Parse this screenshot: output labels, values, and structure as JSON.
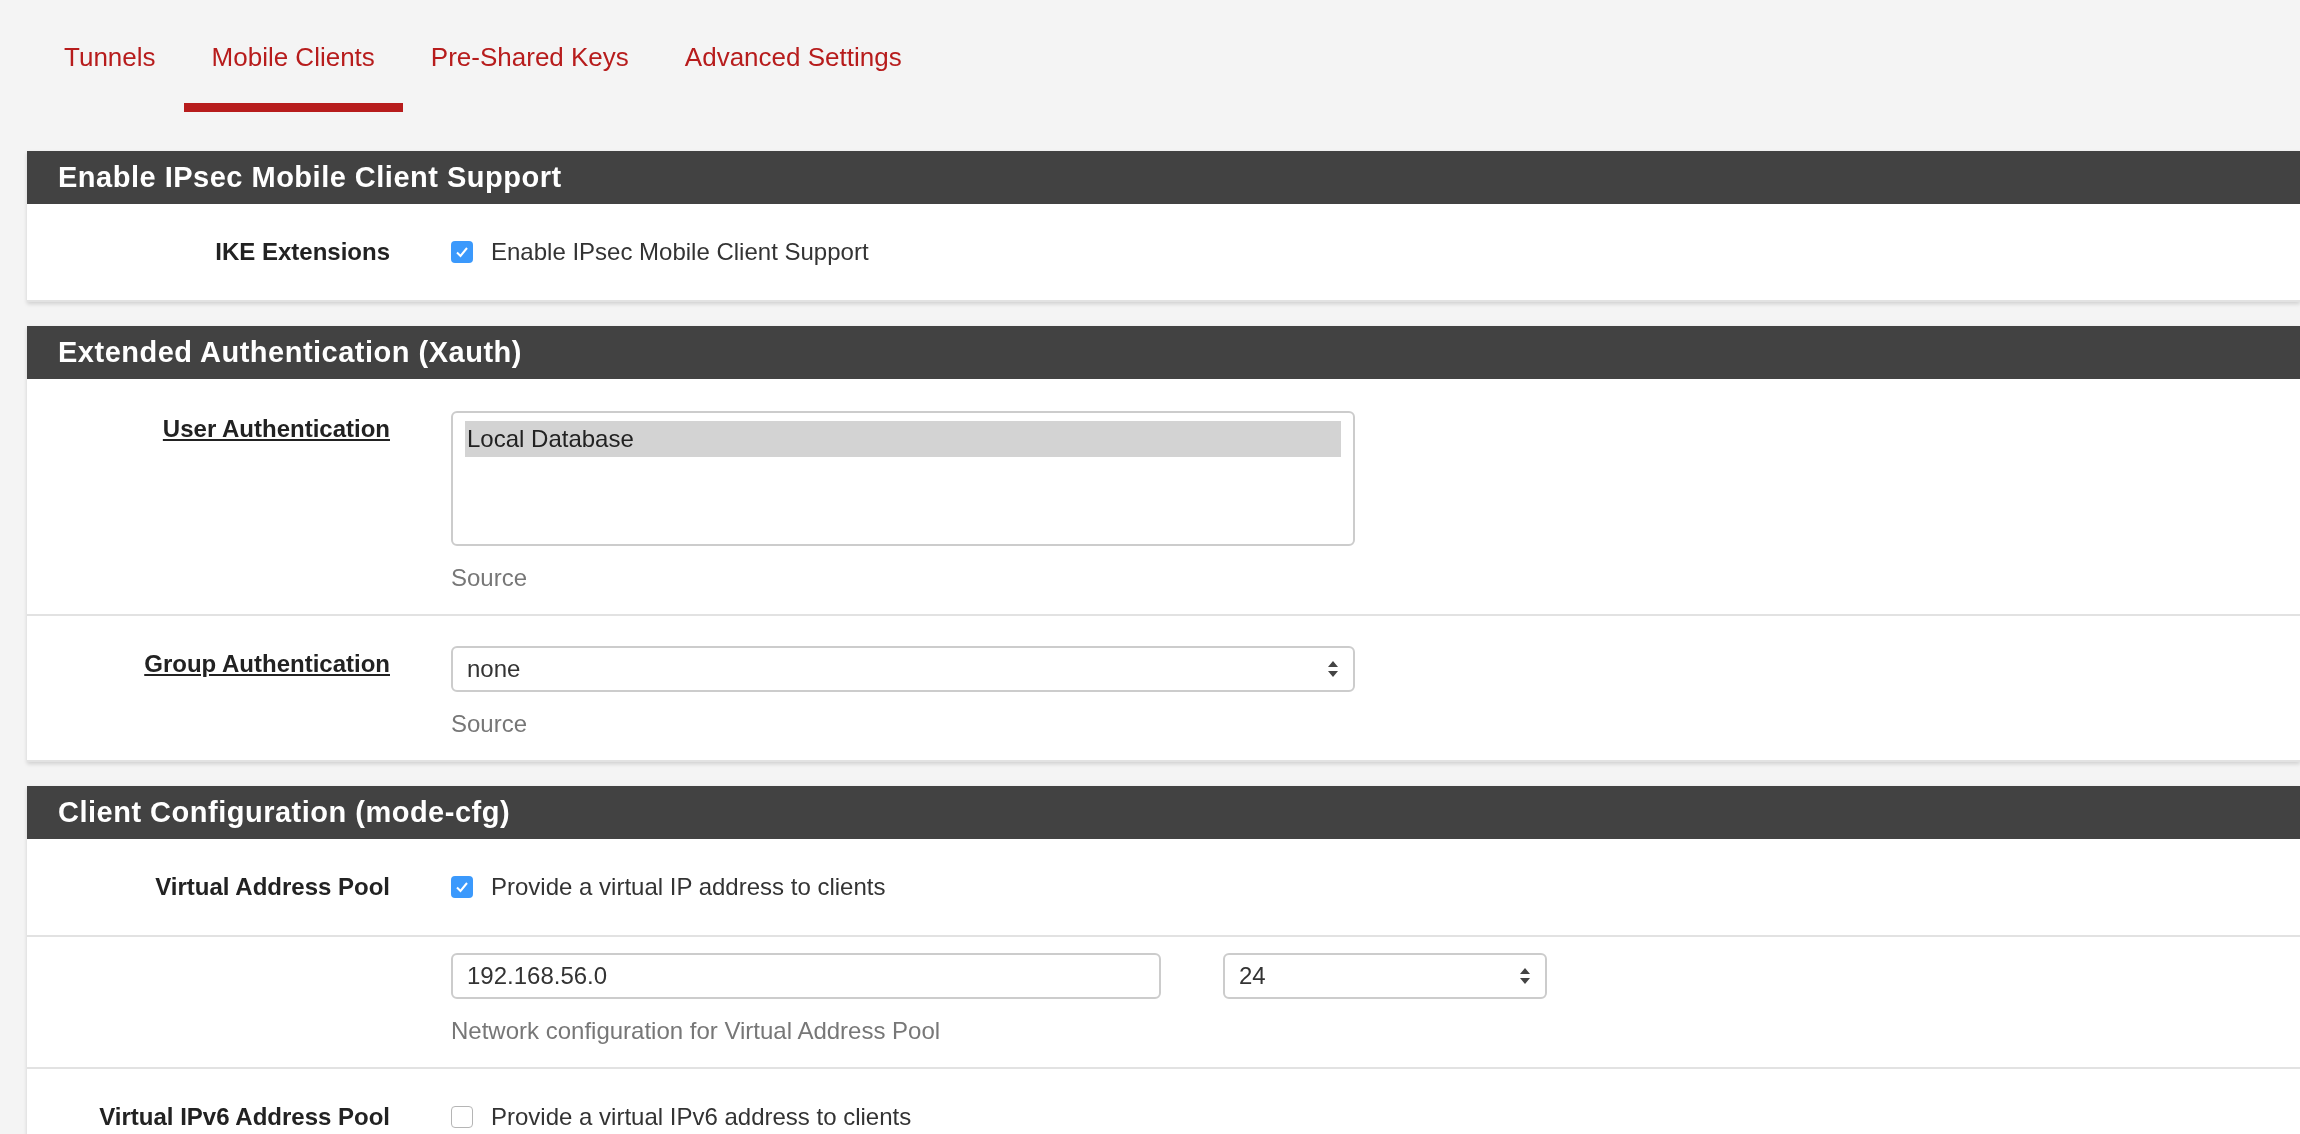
{
  "tabs": [
    {
      "label": "Tunnels",
      "selected": false
    },
    {
      "label": "Mobile Clients",
      "selected": true
    },
    {
      "label": "Pre-Shared Keys",
      "selected": false
    },
    {
      "label": "Advanced Settings",
      "selected": false
    }
  ],
  "sections": [
    {
      "title": "Enable IPsec Mobile Client Support",
      "rows": [
        {
          "kind": "checkbox",
          "label": "IKE Extensions",
          "linked": false,
          "checkbox": {
            "label": "Enable IPsec Mobile Client Support",
            "checked": true
          }
        }
      ]
    },
    {
      "title": "Extended Authentication (Xauth)",
      "rows": [
        {
          "kind": "listbox",
          "label": "User Authentication",
          "linked": true,
          "options": [
            {
              "label": "Local Database",
              "selected": true
            }
          ],
          "help": "Source"
        },
        {
          "kind": "select",
          "label": "Group Authentication",
          "linked": true,
          "value": "none",
          "help": "Source"
        }
      ]
    },
    {
      "title": "Client Configuration (mode-cfg)",
      "rows": [
        {
          "kind": "checkbox",
          "label": "Virtual Address Pool",
          "linked": false,
          "checkbox": {
            "label": "Provide a virtual IP address to clients",
            "checked": true
          }
        },
        {
          "kind": "network",
          "address": "192.168.56.0",
          "mask": "24",
          "help": "Network configuration for Virtual Address Pool"
        },
        {
          "kind": "checkbox",
          "label": "Virtual IPv6 Address Pool",
          "linked": false,
          "checkbox": {
            "label": "Provide a virtual IPv6 address to clients",
            "checked": false
          }
        }
      ]
    }
  ]
}
